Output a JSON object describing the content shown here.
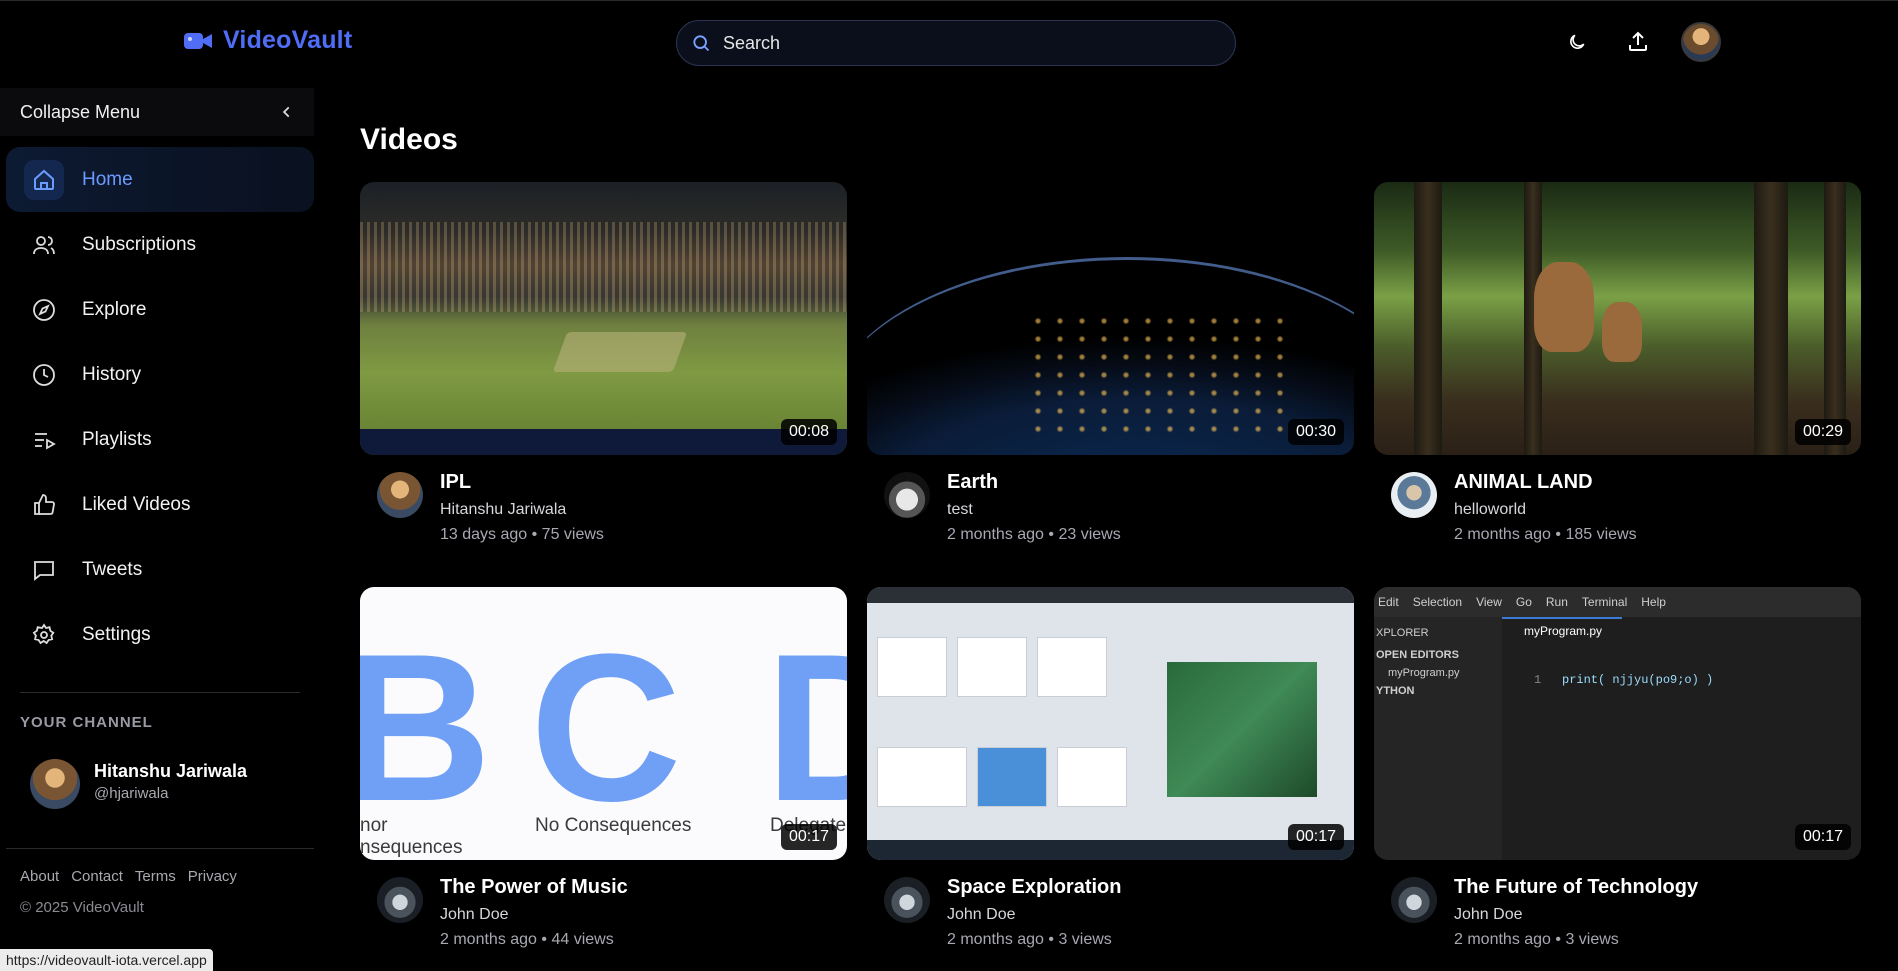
{
  "header": {
    "brand": "VideoVault",
    "search_placeholder": "Search",
    "icons": [
      "video-logo-icon",
      "search-icon",
      "moon-icon",
      "upload-icon"
    ]
  },
  "sidebar": {
    "collapse_label": "Collapse Menu",
    "items": [
      {
        "label": "Home",
        "icon": "home-icon",
        "active": true
      },
      {
        "label": "Subscriptions",
        "icon": "users-icon"
      },
      {
        "label": "Explore",
        "icon": "compass-icon"
      },
      {
        "label": "History",
        "icon": "clock-icon"
      },
      {
        "label": "Playlists",
        "icon": "playlist-icon"
      },
      {
        "label": "Liked Videos",
        "icon": "thumbs-up-icon"
      },
      {
        "label": "Tweets",
        "icon": "message-icon"
      },
      {
        "label": "Settings",
        "icon": "gear-icon"
      }
    ],
    "channel_heading": "YOUR CHANNEL",
    "channel": {
      "name": "Hitanshu Jariwala",
      "handle": "@hjariwala"
    },
    "footer_links": [
      "About",
      "Contact",
      "Terms",
      "Privacy"
    ],
    "copyright": "© 2025 VideoVault"
  },
  "main": {
    "title": "Videos",
    "videos": [
      {
        "title": "IPL",
        "owner": "Hitanshu Jariwala",
        "stats": "13 days ago • 75 views",
        "duration": "00:08"
      },
      {
        "title": "Earth",
        "owner": "test",
        "stats": "2 months ago • 23 views",
        "duration": "00:30"
      },
      {
        "title": "ANIMAL LAND",
        "owner": "helloworld",
        "stats": "2 months ago • 185 views",
        "duration": "00:29"
      },
      {
        "title": "The Power of Music",
        "owner": "John Doe",
        "stats": "2 months ago • 44 views",
        "duration": "00:17"
      },
      {
        "title": "Space Exploration",
        "owner": "John Doe",
        "stats": "2 months ago • 3 views",
        "duration": "00:17"
      },
      {
        "title": "The Future of Technology",
        "owner": "John Doe",
        "stats": "2 months ago • 3 views",
        "duration": "00:17"
      }
    ],
    "thumb_text": {
      "abc_left": "B",
      "abc_mid": "C",
      "abc_right": "D",
      "abc_cap1": "nor",
      "abc_cap2": "nsequences",
      "abc_cap3": "No Consequences",
      "abc_cap4": "Delegate",
      "code_menu": [
        "Edit",
        "Selection",
        "View",
        "Go",
        "Run",
        "Terminal",
        "Help"
      ],
      "code_explorer": "XPLORER",
      "code_open_editors": "OPEN EDITORS",
      "code_file": "myProgram.py",
      "code_python": "YTHON",
      "code_line_no": "1",
      "code_line": "print( njjyu(po9;o) )"
    }
  },
  "statusbar": "https://videovault-iota.vercel.app",
  "colors": {
    "accent": "#4f6df5",
    "active_text": "#6b9bff",
    "background": "#000000"
  }
}
